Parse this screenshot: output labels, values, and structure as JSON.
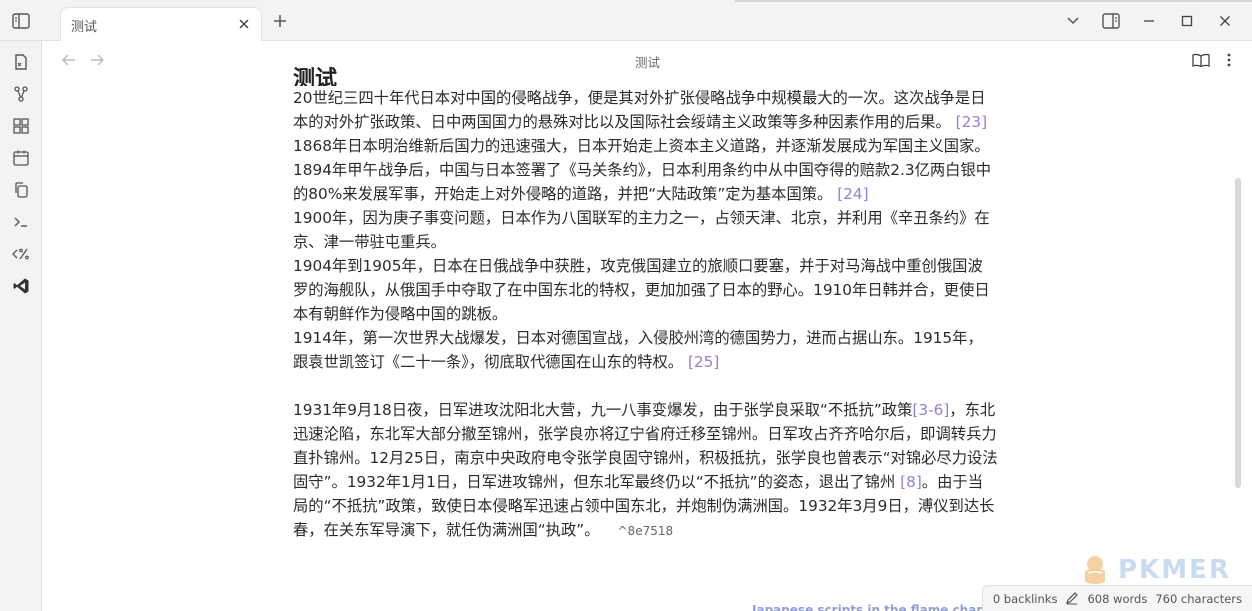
{
  "tab": {
    "title": "测试"
  },
  "view": {
    "title": "测试"
  },
  "doc": {
    "heading": "测试",
    "paragraphs": [
      {
        "text": "20世纪三四十年代日本对中国的侵略战争，便是其对外扩张侵略战争中规模最大的一次。这次战争是日本的对外扩张政策、日中两国国力的悬殊对比以及国际社会绥靖主义政策等多种因素作用的后果。",
        "cite": "[23]"
      },
      {
        "text": "1868年日本明治维新后国力的迅速强大，日本开始走上资本主义道路，并逐渐发展成为军国主义国家。",
        "cite": ""
      },
      {
        "text": "1894年甲午战争后，中国与日本签署了《马关条约》，日本利用条约中从中国夺得的赔款2.3亿两白银中的80%来发展军事，开始走上对外侵略的道路，并把“大陆政策”定为基本国策。",
        "cite": "[24]"
      },
      {
        "text": "1900年，因为庚子事变问题，日本作为八国联军的主力之一，占领天津、北京，并利用《辛丑条约》在京、津一带驻屯重兵。",
        "cite": ""
      },
      {
        "text": "1904年到1905年，日本在日俄战争中获胜，攻克俄国建立的旅顺口要塞，并于对马海战中重创俄国波罗的海舰队，从俄国手中夺取了在中国东北的特权，更加加强了日本的野心。1910年日韩并合，更使日本有朝鲜作为侵略中国的跳板。",
        "cite": ""
      },
      {
        "text": "1914年，第一次世界大战爆发，日本对德国宣战，入侵胶州湾的德国势力，进而占据山东。1915年，跟袁世凯签订《二十一条》，彻底取代德国在山东的特权。",
        "cite": "[25]"
      }
    ],
    "para2": {
      "part1": "1931年9月18日夜，日军进攻沈阳北大营，九一八事变爆发，由于张学良采取“不抵抗”政策",
      "cite1": "[3-6]",
      "part2": "，东北迅速沦陷，东北军大部分撤至锦州，张学良亦将辽宁省府迁移至锦州。日军攻占齐齐哈尔后，即调转兵力直扑锦州。12月25日，南京中央政府电令张学良固守锦州，积极抵抗，张学良也曾表示“对锦必尽力设法固守”。1932年1月1日，日军进攻锦州，但东北军最终仍以“不抵抗”的姿态，退出了锦州",
      "cite2": "[8]",
      "part3": "。由于当局的“不抵抗”政策，致使日本侵略军迅速占领中国东北，并炮制伪满洲国。1932年3月9日，溥仪到达长春，在关东军导演下，就任伪满洲国“执政”。",
      "block_id": "^8e7518"
    }
  },
  "status": {
    "backlinks": "0 backlinks",
    "words": "608 words",
    "characters": "760 characters"
  },
  "watermark": {
    "text": "PKMER"
  },
  "bottom_strip": "Japanese scripts in the flame chart"
}
